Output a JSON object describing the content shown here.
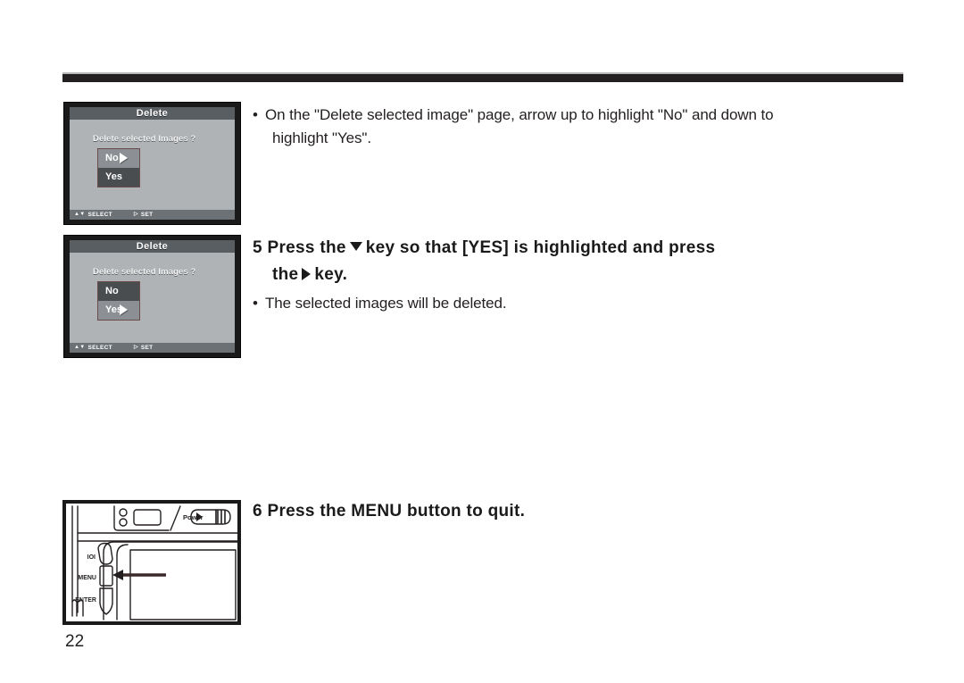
{
  "page": {
    "number": "22"
  },
  "screens": [
    {
      "id": "screen-no-highlighted",
      "title": "Delete",
      "question": "Delete selected Images ?",
      "options": [
        {
          "label": "No",
          "highlighted": true
        },
        {
          "label": "Yes",
          "highlighted": false
        }
      ],
      "footer": {
        "select_glyph": "▲▼",
        "select_label": "SELECT",
        "set_glyph": "▷",
        "set_label": "SET"
      }
    },
    {
      "id": "screen-yes-highlighted",
      "title": "Delete",
      "question": "Delete selected Images ?",
      "options": [
        {
          "label": "No",
          "highlighted": false
        },
        {
          "label": "Yes",
          "highlighted": true
        }
      ],
      "footer": {
        "select_glyph": "▲▼",
        "select_label": "SELECT",
        "set_glyph": "▷",
        "set_label": "SET"
      }
    }
  ],
  "content": {
    "bullet1": {
      "dot": "•",
      "line1": "On the \"Delete selected image\" page, arrow up to highlight \"No\" and down to",
      "line2": "highlight \"Yes\"."
    },
    "step5": {
      "number": "5",
      "part_a": "Press the",
      "part_b": "key so that [YES] is highlighted and press",
      "part_c": "the",
      "part_d": "key."
    },
    "bullet2": {
      "dot": "•",
      "line1": "The selected images will be deleted."
    },
    "step6": {
      "number": "6",
      "text": "Press the MENU button to quit."
    }
  },
  "camera_illustration": {
    "power_label": "Power",
    "buttons": [
      {
        "label": "IOI",
        "name": "display-button"
      },
      {
        "label": "MENU",
        "name": "menu-button"
      },
      {
        "label": "ENTER",
        "name": "enter-button"
      }
    ],
    "callout_arrow_target": "MENU"
  },
  "colors": {
    "rule": "#231f20",
    "lcd_bezel": "#1a1a1a",
    "lcd_screen": "#b0b3b5",
    "lcd_titlebar": "#595e63",
    "lcd_footer": "#6c7176",
    "option_dim": "#4a4d50",
    "option_highlight": "#8c9094",
    "text": "#231f20"
  }
}
